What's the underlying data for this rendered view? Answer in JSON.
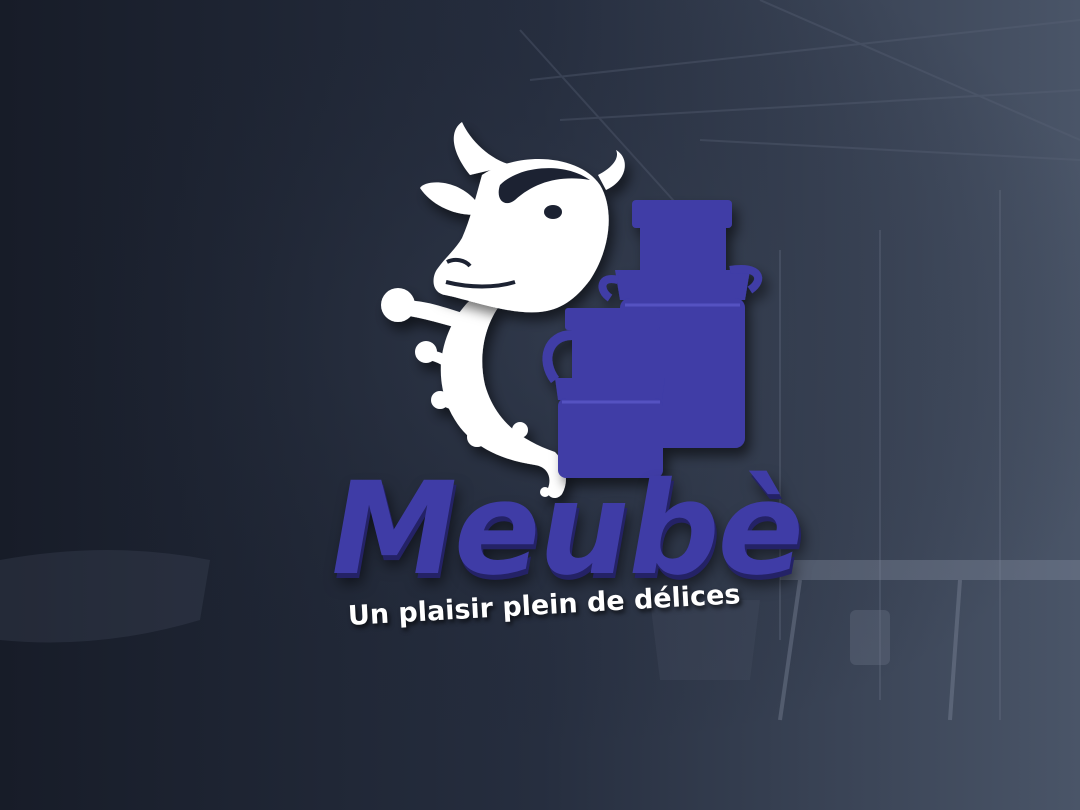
{
  "brand": {
    "name": "Meubè",
    "tagline": "Un plaisir plein de délices"
  },
  "icons": {
    "cow": "cow-head-icon",
    "milk_can": "milk-can-icon",
    "splash": "milk-splash-icon"
  },
  "colors": {
    "brand_blue": "#3f3ca6",
    "milk_white": "#ffffff",
    "background": "#1e2433"
  }
}
